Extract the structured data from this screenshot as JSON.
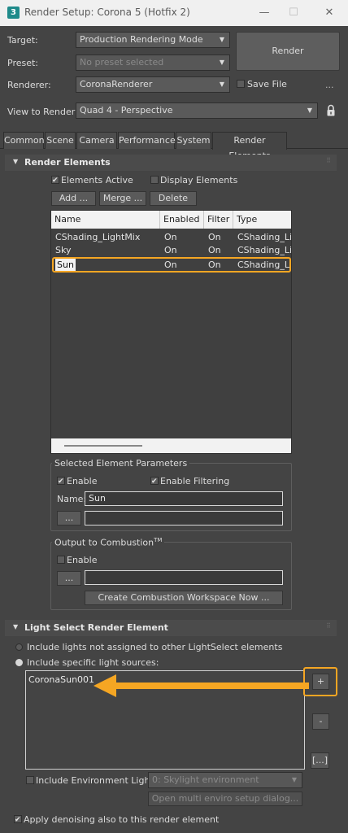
{
  "window": {
    "icon_glyph": "3",
    "title": "Render Setup: Corona 5 (Hotfix 2)",
    "min_glyph": "—",
    "max_glyph": "☐",
    "close_glyph": "✕"
  },
  "top": {
    "target_label": "Target:",
    "target_value": "Production Rendering Mode",
    "preset_label": "Preset:",
    "preset_value": "No preset selected",
    "renderer_label": "Renderer:",
    "renderer_value": "CoronaRenderer",
    "save_file_label": "Save File",
    "save_file_checked": false,
    "more_glyph": "...",
    "view_label": "View to Render:",
    "view_value": "Quad 4 - Perspective",
    "render_button": "Render",
    "lock_icon": "lock-icon"
  },
  "tabs": [
    {
      "label": "Common"
    },
    {
      "label": "Scene"
    },
    {
      "label": "Camera"
    },
    {
      "label": "Performance"
    },
    {
      "label": "System"
    },
    {
      "label": "Render Elements",
      "active": true
    }
  ],
  "render_elements": {
    "title": "Render Elements",
    "elements_active_label": "Elements Active",
    "elements_active_checked": true,
    "display_elements_label": "Display Elements",
    "display_elements_checked": false,
    "add_button": "Add ...",
    "merge_button": "Merge ...",
    "delete_button": "Delete",
    "columns": [
      "Name",
      "Enabled",
      "Filter",
      "Type"
    ],
    "rows": [
      {
        "name": "CShading_LightMix",
        "enabled": "On",
        "filter": "On",
        "type": "CShading_Lig."
      },
      {
        "name": "Sky",
        "enabled": "On",
        "filter": "On",
        "type": "CShading_Lig."
      },
      {
        "name": "Sun",
        "enabled": "On",
        "filter": "On",
        "type": "CShading_Lig.",
        "selected": true
      }
    ],
    "selected_params": {
      "title": "Selected Element Parameters",
      "enable_label": "Enable",
      "enable_checked": true,
      "enable_filtering_label": "Enable Filtering",
      "enable_filtering_checked": true,
      "name_label": "Name:",
      "name_value": "Sun",
      "browse_button": "...",
      "path_value": ""
    },
    "combustion": {
      "title": "Output to Combustion",
      "title_sup": "TM",
      "enable_label": "Enable",
      "enable_checked": false,
      "browse_button": "...",
      "path_value": "",
      "create_button": "Create Combustion Workspace Now ..."
    }
  },
  "light_select": {
    "title": "Light Select Render Element",
    "option_not_assigned": "Include lights not assigned to other LightSelect elements",
    "option_specific": "Include specific light sources:",
    "selected_option": "specific",
    "lights": [
      "CoronaSun001"
    ],
    "add_button": "+",
    "remove_button": "-",
    "browse_button": "[...]",
    "include_env_label": "Include Environment Light",
    "include_env_checked": false,
    "env_value": "0: Skylight environment",
    "enviro_button": "Open multi enviro setup dialog...",
    "denoise_label": "Apply denoising also to this render element",
    "denoise_checked": true
  },
  "colors": {
    "highlight": "#f5a623",
    "panel": "#444444",
    "accent_teal": "#1f8a8a"
  }
}
